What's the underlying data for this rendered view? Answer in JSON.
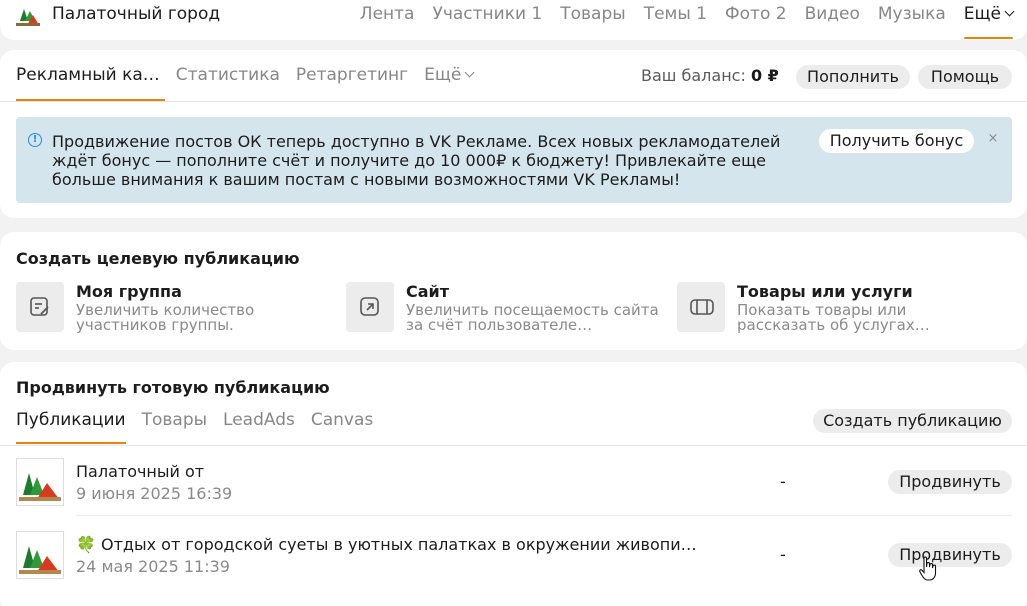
{
  "group": {
    "name": "Палаточный город",
    "nav": [
      "Лента",
      "Участники 1",
      "Товары",
      "Темы 1",
      "Фото 2",
      "Видео",
      "Музыка",
      "Ещё"
    ]
  },
  "ads": {
    "tabs": [
      "Рекламный ка…",
      "Статистика",
      "Ретаргетинг",
      "Ещё"
    ],
    "balance_label": "Ваш баланс:",
    "balance_value": "0 ₽",
    "topup_label": "Пополнить",
    "help_label": "Помощь",
    "promo": {
      "text": "Продвижение постов ОК теперь доступно в VK Рекламе. Всех новых рекламодателей ждёт бонус — пополните счёт и получите до 10 000₽ к бюджету! Привлекайте еще больше внимания к вашим постам с новыми возможностями VK Рекламы!",
      "bonus_label": "Получить бонус",
      "close": "×"
    }
  },
  "create": {
    "title": "Создать целевую публикацию",
    "options": [
      {
        "title": "Моя группа",
        "desc": "Увеличить количество участников группы."
      },
      {
        "title": "Сайт",
        "desc": "Увеличить посещаемость сайта за счёт пользователе…"
      },
      {
        "title": "Товары или услуги",
        "desc": "Показать товары или рассказать об услугах…"
      }
    ]
  },
  "promote": {
    "title": "Продвинуть готовую публикацию",
    "tabs": [
      "Публикации",
      "Товары",
      "LeadAds",
      "Canvas"
    ],
    "create_label": "Создать публикацию",
    "rows": [
      {
        "emoji": "",
        "title": "Палаточный от",
        "date": "9 июня 2025 16:39",
        "stat": "-",
        "button": "Продвинуть"
      },
      {
        "emoji": "🍀",
        "title": "Отдых от городской суеты в уютных палатках в окружении живопи…",
        "date": "24 мая 2025 11:39",
        "stat": "-",
        "button": "Продвинуть"
      }
    ]
  },
  "colors": {
    "accent": "#ee8208",
    "promo_bg": "#d5e5ee",
    "info_icon": "#1d8fd8"
  }
}
